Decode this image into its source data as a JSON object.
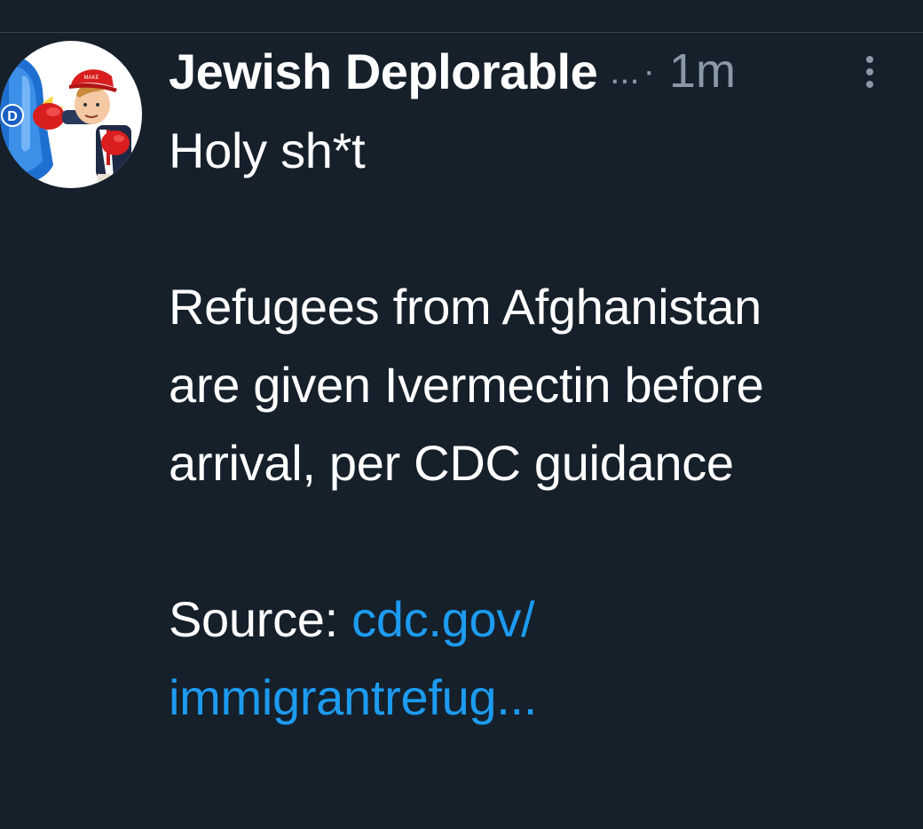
{
  "tweet": {
    "display_name": "Jewish Deplorable",
    "name_truncation": "...",
    "separator": "·",
    "timestamp": "1m",
    "lines": {
      "line1": "Holy sh*t",
      "line2": "Refugees from Afghanistan",
      "line3": "are given Ivermectin before",
      "line4": "arrival, per CDC guidance",
      "source_label": "Source: ",
      "link_part1": "cdc.gov/",
      "link_part2": "immigrantrefug..."
    },
    "avatar_badge": "D"
  },
  "colors": {
    "background": "#15202b",
    "text": "#ffffff",
    "secondary_text": "#8b98a5",
    "link": "#1d9bf0",
    "divider": "#38444d"
  },
  "icons": {
    "more": "more-vertical-icon"
  }
}
